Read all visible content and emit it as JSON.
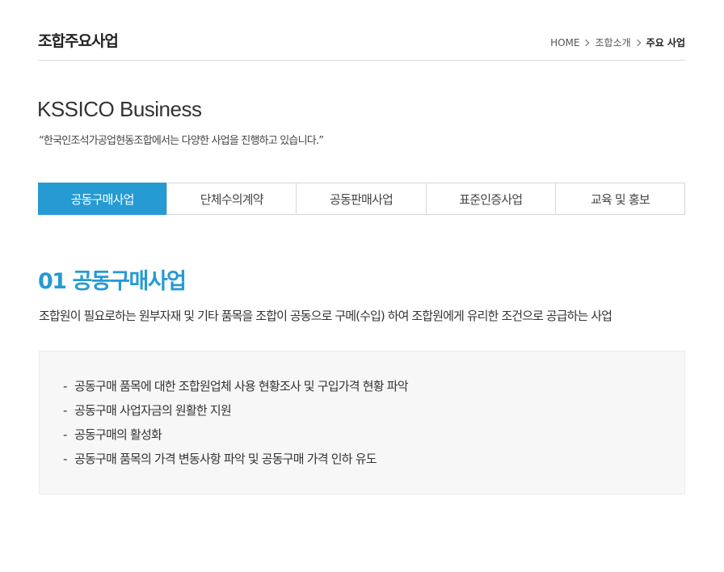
{
  "header": {
    "page_title": "조합주요사업",
    "breadcrumb": [
      "HOME",
      "조합소개",
      "주요 사업"
    ]
  },
  "intro": {
    "title": "KSSICO Business",
    "subtitle": "“한국인조석가공업현동조합에서는 다양한 사업을 진행하고 있습니다.”"
  },
  "tabs": [
    {
      "label": "공동구매사업",
      "active": true
    },
    {
      "label": "단체수의계약",
      "active": false
    },
    {
      "label": "공동판매사업",
      "active": false
    },
    {
      "label": "표준인증사업",
      "active": false
    },
    {
      "label": "교육 및 홍보",
      "active": false
    }
  ],
  "section": {
    "title": "01 공동구매사업",
    "description": "조합원이 필요로하는 원부자재 및 기타 품목을 조합이 공동으로 구메(수입) 하여 조합원에게 유리한 조건으로 공급하는 사업",
    "items": [
      "공동구매 품목에 대한 조합원업체 사용 현황조사 및 구입가격 현황 파악",
      "공동구매 사업자금의 원활한 지원",
      "공동구매의 활성화",
      "공동구매 품목의 가격 변동사항 파악 및 공동구매 가격 인하 유도"
    ],
    "bullet": "-"
  },
  "colors": {
    "accent": "#269ad3",
    "box_bg": "#f7f7f7"
  }
}
